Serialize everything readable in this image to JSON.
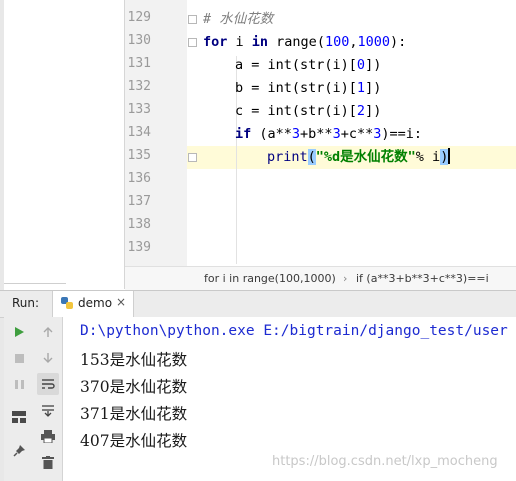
{
  "editor": {
    "line_numbers": [
      "129",
      "130",
      "131",
      "132",
      "133",
      "134",
      "135",
      "136",
      "137",
      "138",
      "139"
    ],
    "lines": {
      "l129": "# 水仙花数",
      "l130_for": "for",
      "l130_i": " i ",
      "l130_in": "in",
      "l130_range": " range(",
      "l130_n1": "100",
      "l130_comma": ",",
      "l130_n2": "1000",
      "l130_end": "):",
      "l131_pre": "a = int(str(i)[",
      "l131_idx": "0",
      "l131_end": "])",
      "l132_pre": "b = int(str(i)[",
      "l132_idx": "1",
      "l132_end": "])",
      "l133_pre": "c = int(str(i)[",
      "l133_idx": "2",
      "l133_end": "])",
      "l134_if": "if",
      "l134_pre": " (a**",
      "l134_n1": "3",
      "l134_mid1": "+b**",
      "l134_n2": "3",
      "l134_mid2": "+c**",
      "l134_n3": "3",
      "l134_end": ")==i:",
      "l135_print": "print",
      "l135_open": "(",
      "l135_str": "\"%d是水仙花数\"",
      "l135_rest": "% i",
      "l135_close": ")"
    }
  },
  "breadcrumb": {
    "first": "for i in range(100,1000)",
    "separator": "›",
    "second": "if (a**3+b**3+c**3)==i"
  },
  "run_panel": {
    "label": "Run:",
    "tab_name": "demo",
    "tab_close": "×",
    "command": "D:\\python\\python.exe E:/bigtrain/django_test/user",
    "output": [
      "153是水仙花数",
      "370是水仙花数",
      "371是水仙花数",
      "407是水仙花数"
    ]
  },
  "watermark": "https://blog.csdn.net/lxp_mocheng",
  "colors": {
    "keyword": "#000080",
    "number": "#0000ff",
    "string": "#008000",
    "comment": "#808080",
    "current_line": "#fffbd8",
    "run_green": "#3f9e3f"
  },
  "icons": [
    "run-icon",
    "arrow-up-icon",
    "stop-icon",
    "arrow-down-icon",
    "pause-icon",
    "soft-wrap-icon",
    "layout-icon",
    "scroll-to-end-icon",
    "pin-icon",
    "print-icon",
    "trash-icon",
    "python-file-icon",
    "close-icon"
  ]
}
